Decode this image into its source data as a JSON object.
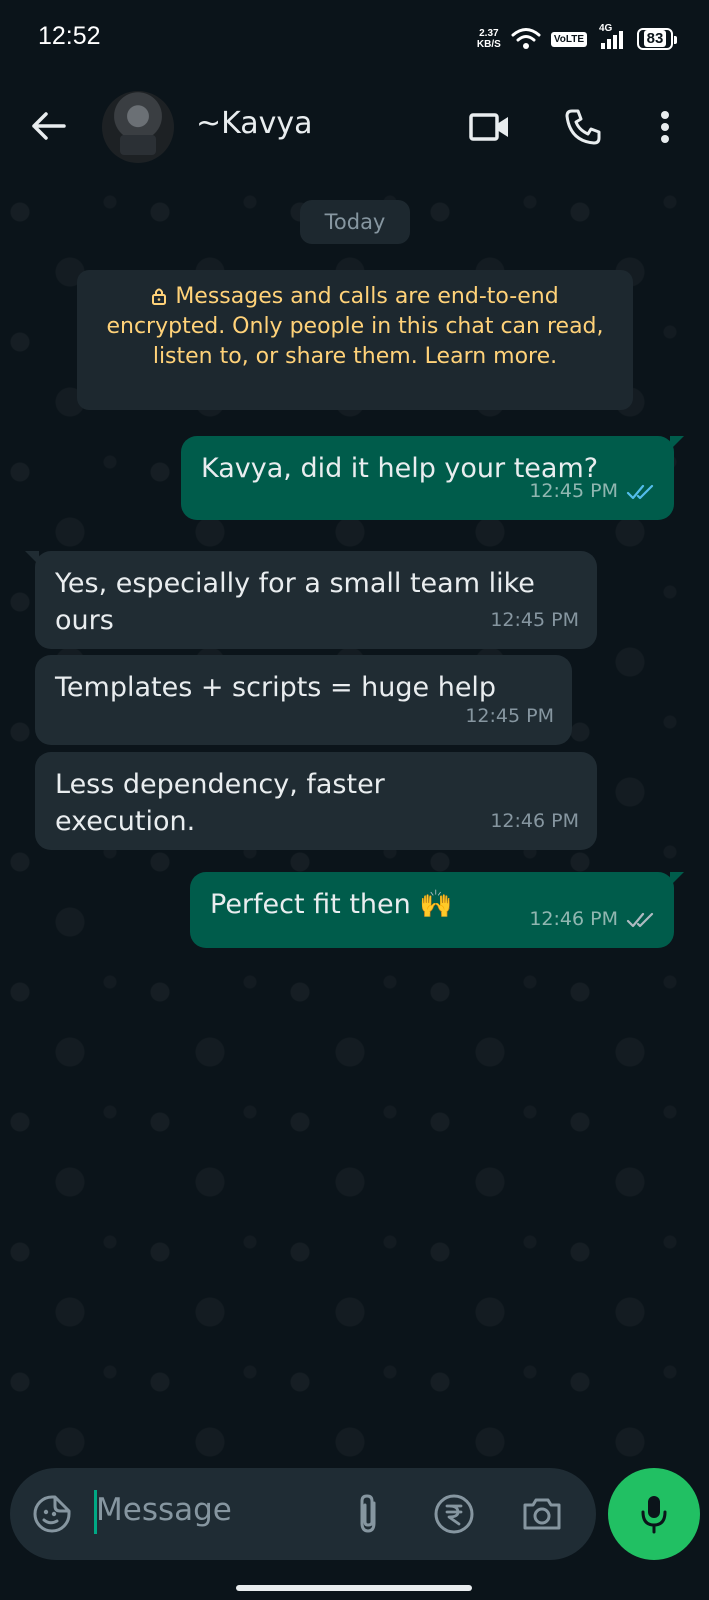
{
  "status_bar": {
    "time": "12:52",
    "net_speed_value": "2.37",
    "net_speed_unit": "KB/S",
    "volte": "VoLTE",
    "network": "4G",
    "battery": "83"
  },
  "header": {
    "contact_name": "~Kavya",
    "icons": [
      "back-arrow-icon",
      "video-call-icon",
      "phone-call-icon",
      "more-vert-icon"
    ]
  },
  "chat": {
    "date_chip": "Today",
    "encryption_notice": "Messages and calls are end-to-end encrypted. Only people in this chat can read, listen to, or share them. Learn more.",
    "messages": [
      {
        "direction": "out",
        "text": "Kavya, did it help your team?",
        "time": "12:45 PM",
        "ticks": "read"
      },
      {
        "direction": "in",
        "text": "Yes, especially for a small team like ours",
        "time": "12:45 PM"
      },
      {
        "direction": "in",
        "text": "Templates + scripts = huge help",
        "time": "12:45 PM"
      },
      {
        "direction": "in",
        "text": "Less dependency, faster execution.",
        "time": "12:46 PM"
      },
      {
        "direction": "out",
        "text": "Perfect fit then 🙌",
        "time": "12:46 PM",
        "ticks": "delivered"
      }
    ]
  },
  "input": {
    "placeholder": "Message",
    "icons": [
      "sticker-icon",
      "attach-icon",
      "rupee-payment-icon",
      "camera-icon",
      "mic-icon"
    ]
  },
  "colors": {
    "background": "#0b141a",
    "outgoing_bubble": "#005c4b",
    "incoming_bubble": "#202c33",
    "notice_text": "#ffd279",
    "read_ticks": "#53bdeb",
    "mic_button": "#21c063"
  }
}
